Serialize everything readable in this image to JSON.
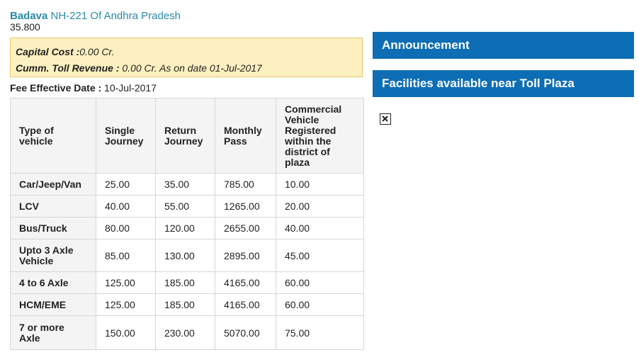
{
  "plaza": {
    "name": "Badava",
    "highway": "NH-221 Of Andhra Pradesh",
    "distance": "35.800"
  },
  "cost": {
    "capital_label": "Capital Cost :",
    "capital_value": "0.00 Cr.",
    "toll_label": "Cumm. Toll Revenue :",
    "toll_value": " 0.00 Cr. As on date 01-Jul-2017"
  },
  "fee": {
    "label": "Fee Effective Date :",
    "date": " 10-Jul-2017"
  },
  "table": {
    "headers": [
      "Type of vehicle",
      "Single Journey",
      "Return Journey",
      "Monthly Pass",
      "Commercial Vehicle Registered within the district of plaza"
    ],
    "rows": [
      [
        "Car/Jeep/Van",
        "25.00",
        "35.00",
        "785.00",
        "10.00"
      ],
      [
        "LCV",
        "40.00",
        "55.00",
        "1265.00",
        "20.00"
      ],
      [
        "Bus/Truck",
        "80.00",
        "120.00",
        "2655.00",
        "40.00"
      ],
      [
        "Upto 3 Axle Vehicle",
        "85.00",
        "130.00",
        "2895.00",
        "45.00"
      ],
      [
        "4 to 6 Axle",
        "125.00",
        "185.00",
        "4165.00",
        "60.00"
      ],
      [
        "HCM/EME",
        "125.00",
        "185.00",
        "4165.00",
        "60.00"
      ],
      [
        "7 or more Axle",
        "150.00",
        "230.00",
        "5070.00",
        "75.00"
      ]
    ]
  },
  "panels": {
    "announcement": "Announcement",
    "facilities": "Facilities available near Toll Plaza"
  },
  "icons": {
    "broken_image": "broken-image-icon"
  },
  "colors": {
    "link": "#2a8aa8",
    "panel": "#0d6eb5",
    "notice_bg": "#fdf0c0"
  }
}
